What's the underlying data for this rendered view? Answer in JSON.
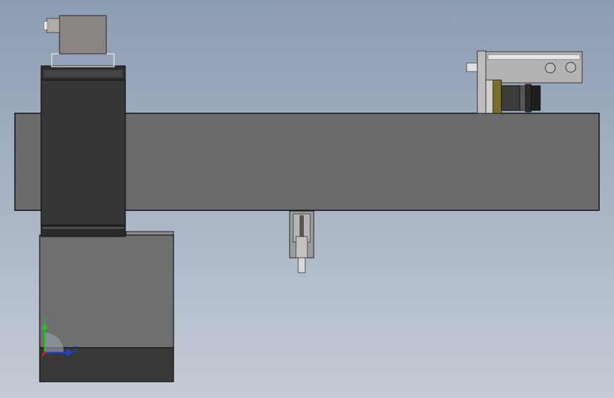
{
  "viewport": {
    "background_top": "#8c9db3",
    "background_bottom": "#c4cbd6"
  },
  "triad": {
    "y_label": "Y",
    "z_label": "Z",
    "y_color": "#1fc21f",
    "z_color": "#1f3fe0",
    "x_color": "#d01f1f"
  },
  "colors": {
    "beam": "#6b6b6b",
    "column_dark": "#353535",
    "base": "#6f6f6f",
    "base_foot": "#383838",
    "connector": "#8a8582",
    "bracket": "#9a9a9a",
    "slider_body": "#b3b3b3",
    "accent_olive": "#7a6e2a"
  }
}
